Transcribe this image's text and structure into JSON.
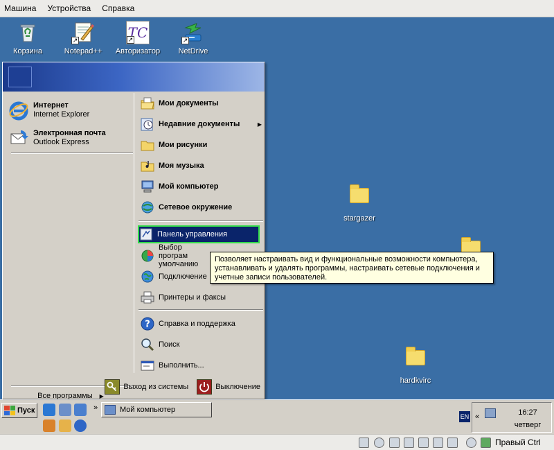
{
  "host_menu": [
    "Машина",
    "Устройства",
    "Справка"
  ],
  "desktop_icons": {
    "recycle": "Корзина",
    "notepad": "Notepad++",
    "authorizer": "Авторизатор",
    "authorizer_glyph": "TC",
    "netdrive": "NetDrive",
    "stargazer": "stargazer",
    "hardkvirc": "hardkvirc"
  },
  "start_menu": {
    "pinned": [
      {
        "title": "Интернет",
        "subtitle": "Internet Explorer",
        "icon": "ie-icon"
      },
      {
        "title": "Электронная почта",
        "subtitle": "Outlook Express",
        "icon": "outlook-icon"
      }
    ],
    "all_programs": "Все программы",
    "right": {
      "my_documents": "Мои документы",
      "recent_documents": "Недавние документы",
      "my_pictures": "Мои рисунки",
      "my_music": "Моя музыка",
      "my_computer": "Мой компьютер",
      "network": "Сетевое окружение",
      "control_panel": "Панель управления",
      "default_programs": "Выбор програм умолчанию",
      "connect": "Подключение",
      "printers": "Принтеры и факсы",
      "help": "Справка и поддержка",
      "search": "Поиск",
      "run": "Выполнить..."
    },
    "logoff": "Выход из системы",
    "shutdown": "Выключение"
  },
  "tooltip": "Позволяет настраивать вид и функциональные возможности компьютера, устанавливать и удалять программы,  настраивать сетевые подключения и учетные записи пользователей.",
  "taskbar": {
    "start": "Пуск",
    "chevron": "»",
    "task_my_computer": "Мой компьютер",
    "lang": "EN",
    "tray_chevron": "«",
    "time": "16:27",
    "day": "четверг"
  },
  "host_status": {
    "host_key": "Правый Ctrl"
  },
  "colors": {
    "desktop": "#3a6ea5",
    "highlight": "#0a246a",
    "highlight_outline": "#32d94b",
    "tooltip_bg": "#ffffe1"
  }
}
